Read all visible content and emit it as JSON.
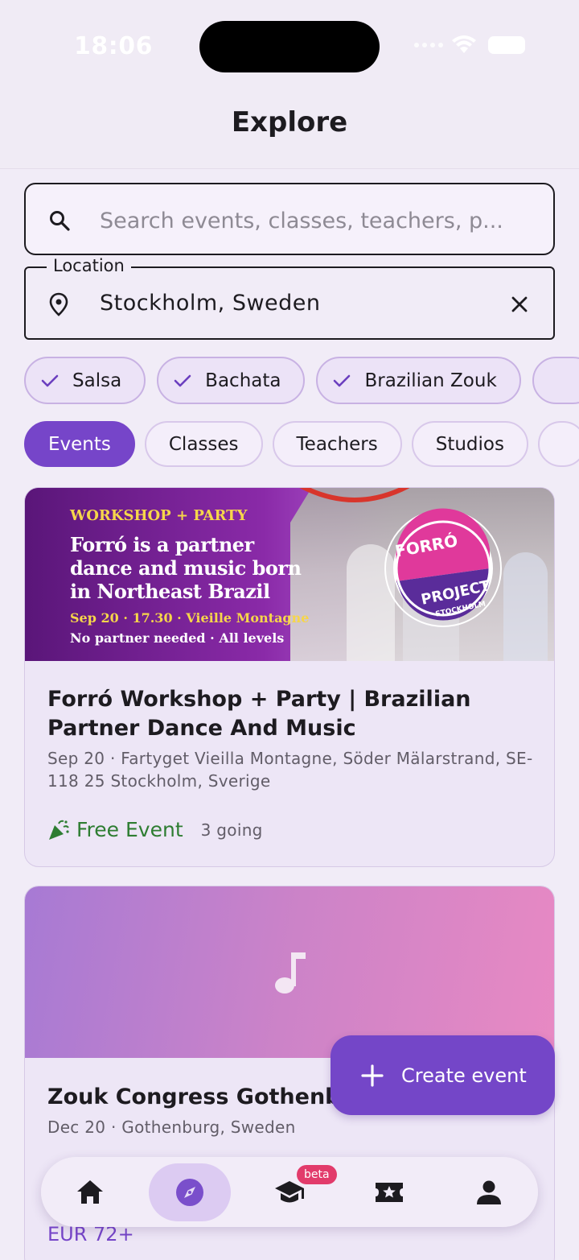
{
  "status_bar": {
    "time": "18:06"
  },
  "header": {
    "title": "Explore"
  },
  "search": {
    "placeholder": "Search events, classes, teachers, p..."
  },
  "location": {
    "label": "Location",
    "value": "Stockholm, Sweden"
  },
  "style_chips": [
    {
      "label": "Salsa",
      "selected": true
    },
    {
      "label": "Bachata",
      "selected": true
    },
    {
      "label": "Brazilian Zouk",
      "selected": true
    }
  ],
  "tabs": [
    {
      "label": "Events",
      "active": true
    },
    {
      "label": "Classes",
      "active": false
    },
    {
      "label": "Teachers",
      "active": false
    },
    {
      "label": "Studios",
      "active": false
    }
  ],
  "events": [
    {
      "banner": {
        "tag": "WORKSHOP + PARTY",
        "lines": [
          "Forró is a partner",
          "dance and music born",
          "in Northeast Brazil"
        ],
        "date_line": "Sep 20 · 17.30 · Vieille Montagne",
        "foot": "No partner needed · All levels",
        "badge_top": "FORRÓ",
        "badge_mid": "PROJECT",
        "badge_bot": "STOCKHOLM"
      },
      "title": "Forró Workshop + Party | Brazilian Partner Dance And Music",
      "subtitle": "Sep 20 · Fartyget Vieilla Montagne, Söder Mälarstrand, SE-118 25 Stockholm, Sverige",
      "price": "Free Event",
      "going": "3 going"
    },
    {
      "title": "Zouk Congress Gothenbu",
      "subtitle": "Dec 20 · Gothenburg, Sweden",
      "price": "EUR 72+"
    }
  ],
  "fab": {
    "label": "Create event"
  },
  "bottom_nav": {
    "items": [
      "home-icon",
      "compass-icon",
      "graduation-cap-icon",
      "ticket-star-icon",
      "profile-icon"
    ],
    "active": "compass-icon",
    "beta_label": "beta"
  },
  "colors": {
    "accent": "#7645c9",
    "free": "#2e7d32",
    "beta": "#e23b6b"
  }
}
